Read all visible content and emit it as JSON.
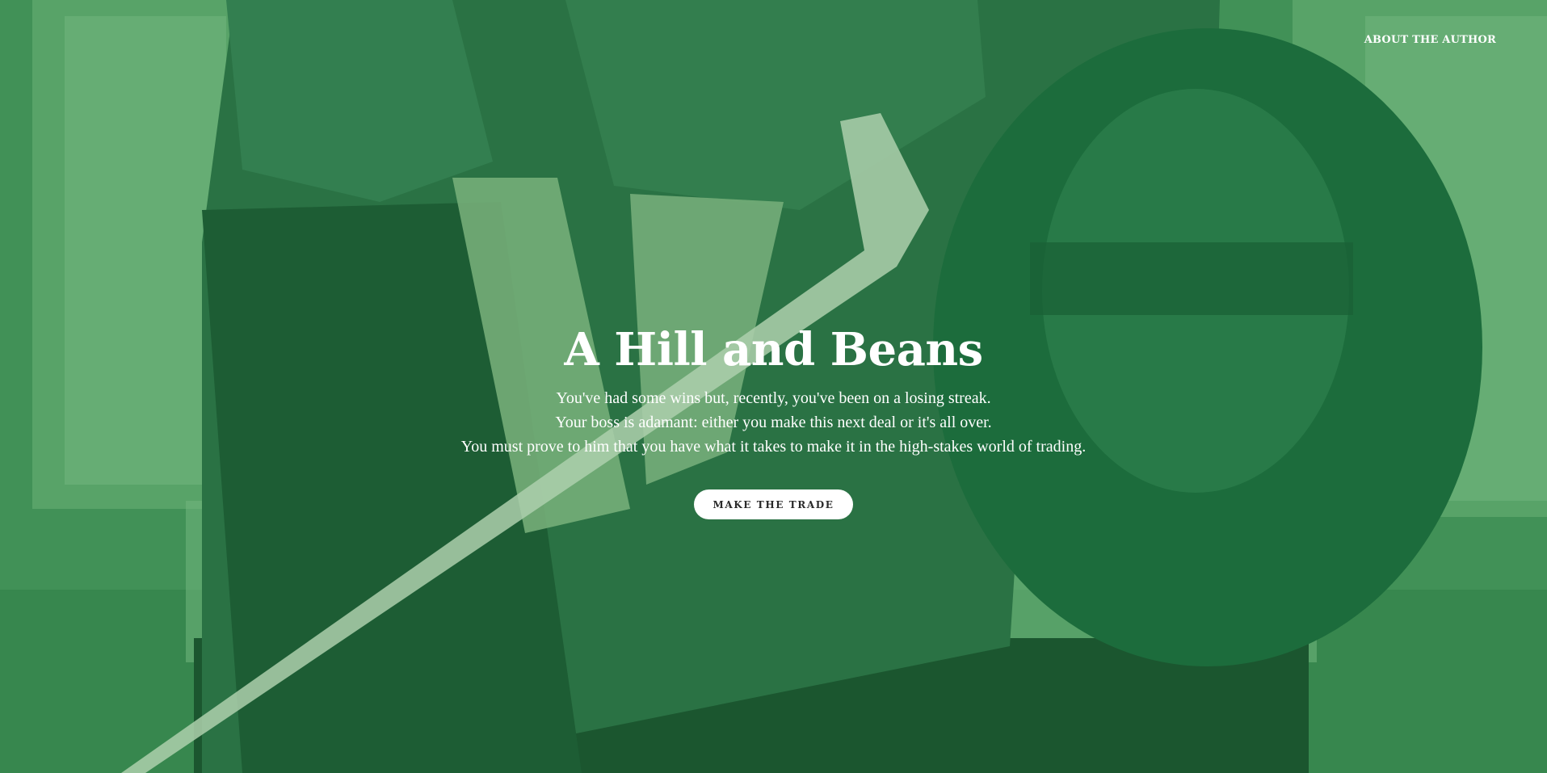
{
  "nav": {
    "about_label": "ABOUT THE AUTHOR"
  },
  "hero": {
    "title": "A Hill and Beans",
    "lines": [
      "You've had some wins but, recently, you've been on a losing streak.",
      "Your boss is adamant: either you make this next deal or it's all over.",
      "You must prove to him that you have what it takes to make it in the high-stakes world of trading."
    ],
    "cta_label": "MAKE THE TRADE"
  },
  "colors": {
    "tint": "#2f7a47",
    "text": "#ffffff",
    "button_bg": "#ffffff",
    "button_text": "#2a2a2a"
  }
}
